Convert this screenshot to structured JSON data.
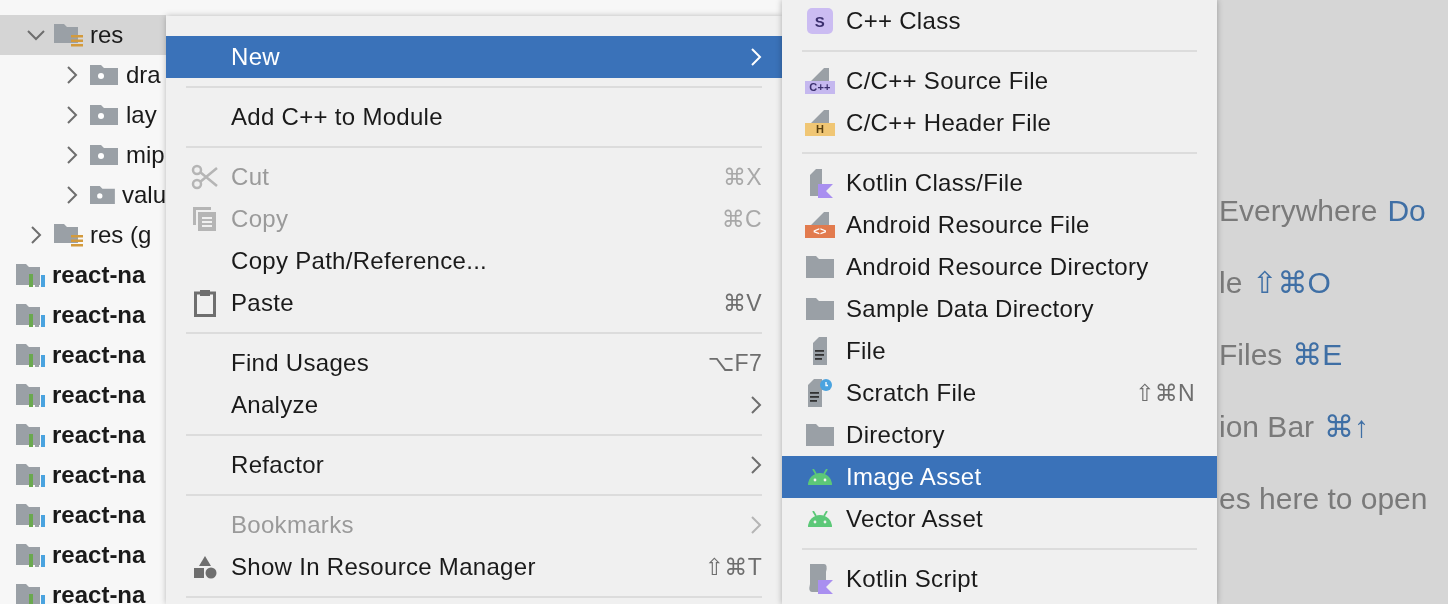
{
  "tree": {
    "items": [
      {
        "label": "res",
        "kind": "res_folder",
        "expanded": true,
        "selected": true,
        "children": [
          {
            "label": "dra",
            "kind": "folder",
            "expanded": false,
            "selected": false
          },
          {
            "label": "lay",
            "kind": "folder",
            "expanded": false,
            "selected": false
          },
          {
            "label": "mip",
            "kind": "folder",
            "expanded": false,
            "selected": false
          },
          {
            "label": "valu",
            "kind": "folder",
            "expanded": false,
            "selected": false
          }
        ]
      },
      {
        "label": "res (g",
        "kind": "res_folder",
        "expanded": false,
        "selected": false
      },
      {
        "label": "react-na",
        "kind": "module",
        "selected": false
      },
      {
        "label": "react-na",
        "kind": "module",
        "selected": false
      },
      {
        "label": "react-na",
        "kind": "module",
        "selected": false
      },
      {
        "label": "react-na",
        "kind": "module",
        "selected": false
      },
      {
        "label": "react-na",
        "kind": "module",
        "selected": false
      },
      {
        "label": "react-na",
        "kind": "module",
        "selected": false
      },
      {
        "label": "react-na",
        "kind": "module",
        "selected": false
      },
      {
        "label": "react-na",
        "kind": "module",
        "selected": false
      },
      {
        "label": "react-na",
        "kind": "module",
        "selected": false
      }
    ]
  },
  "context_menu": {
    "items": [
      {
        "kind": "item",
        "label": "New",
        "selected": true,
        "disabled": false,
        "has_submenu": true
      },
      {
        "kind": "separator"
      },
      {
        "kind": "item",
        "label": "Add C++ to Module",
        "selected": false,
        "disabled": false
      },
      {
        "kind": "separator"
      },
      {
        "kind": "item",
        "label": "Cut",
        "shortcut": "⌘X",
        "selected": false,
        "disabled": true
      },
      {
        "kind": "item",
        "label": "Copy",
        "shortcut": "⌘C",
        "selected": false,
        "disabled": true
      },
      {
        "kind": "item",
        "label": "Copy Path/Reference...",
        "selected": false,
        "disabled": false
      },
      {
        "kind": "item",
        "label": "Paste",
        "shortcut": "⌘V",
        "selected": false,
        "disabled": false
      },
      {
        "kind": "separator"
      },
      {
        "kind": "item",
        "label": "Find Usages",
        "shortcut": "⌥F7",
        "selected": false,
        "disabled": false
      },
      {
        "kind": "item",
        "label": "Analyze",
        "selected": false,
        "disabled": false,
        "has_submenu": true
      },
      {
        "kind": "separator"
      },
      {
        "kind": "item",
        "label": "Refactor",
        "selected": false,
        "disabled": false,
        "has_submenu": true
      },
      {
        "kind": "separator"
      },
      {
        "kind": "item",
        "label": "Bookmarks",
        "selected": false,
        "disabled": true,
        "has_submenu": true
      },
      {
        "kind": "item",
        "label": "Show In Resource Manager",
        "shortcut": "⇧⌘T",
        "selected": false,
        "disabled": false
      },
      {
        "kind": "separator"
      }
    ]
  },
  "new_submenu": {
    "items": [
      {
        "kind": "item",
        "label": "C++ Class",
        "icon_text": "S",
        "selected": false
      },
      {
        "kind": "separator"
      },
      {
        "kind": "item",
        "label": "C/C++ Source File",
        "icon_text": "C++",
        "selected": false
      },
      {
        "kind": "item",
        "label": "C/C++ Header File",
        "icon_text": "H",
        "selected": false
      },
      {
        "kind": "separator"
      },
      {
        "kind": "item",
        "label": "Kotlin Class/File",
        "selected": false
      },
      {
        "kind": "item",
        "label": "Android Resource File",
        "icon_text": "<>",
        "selected": false
      },
      {
        "kind": "item",
        "label": "Android Resource Directory",
        "selected": false
      },
      {
        "kind": "item",
        "label": "Sample Data Directory",
        "selected": false
      },
      {
        "kind": "item",
        "label": "File",
        "selected": false
      },
      {
        "kind": "item",
        "label": "Scratch File",
        "shortcut": "⇧⌘N",
        "selected": false
      },
      {
        "kind": "item",
        "label": "Directory",
        "selected": false
      },
      {
        "kind": "item",
        "label": "Image Asset",
        "selected": true
      },
      {
        "kind": "item",
        "label": "Vector Asset",
        "selected": false
      },
      {
        "kind": "separator"
      },
      {
        "kind": "item",
        "label": "Kotlin Script",
        "selected": false
      }
    ]
  },
  "editor_hints": [
    {
      "text": "Everywhere",
      "shortcut": "Do"
    },
    {
      "text": "le",
      "shortcut": "⇧⌘O"
    },
    {
      "text": "Files",
      "shortcut": "⌘E"
    },
    {
      "text": "ion Bar",
      "shortcut": "⌘↑"
    },
    {
      "text": "es here to open"
    }
  ]
}
